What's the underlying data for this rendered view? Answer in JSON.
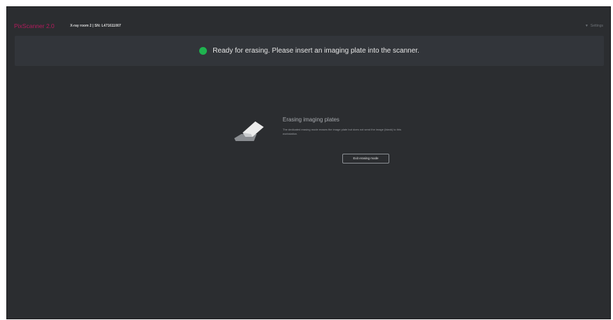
{
  "header": {
    "brand": "PixScanner 2.0",
    "device_info": "X-ray room 2 | SN: L471611007",
    "menu_label": "Settings"
  },
  "status": {
    "message": "Ready for erasing. Please insert an imaging plate into the scanner.",
    "indicator_color": "#1fb34f"
  },
  "erasing": {
    "icon": "eraser-icon",
    "title": "Erasing imaging plates",
    "description": "The dedicated erasing mode erases the image plate but does not send the image (blank) to this workstation.",
    "exit_button_label": "Exit erasing mode"
  },
  "colors": {
    "background": "#2b2d30",
    "brand": "#b31b5c",
    "status_ready": "#1fb34f"
  }
}
